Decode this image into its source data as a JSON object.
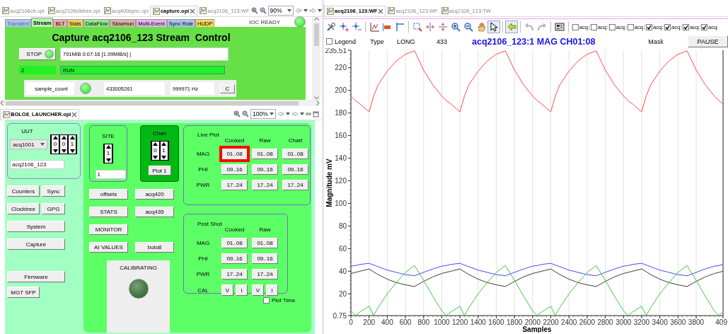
{
  "editor_top": {
    "tabs": [
      {
        "label": "acq2106ctr.opi",
        "selected": false
      },
      {
        "label": "acq2106clktree.opi",
        "selected": false
      },
      {
        "label": "acq400sync.opi",
        "selected": false
      },
      {
        "label": "capture.opi",
        "selected": true
      },
      {
        "label": "acq2106_123:WF",
        "selected": false
      }
    ],
    "zoom": "90%",
    "stream_tabs": [
      {
        "label": "Transient",
        "selected": false,
        "disabled": true,
        "color": "#a9c6ee"
      },
      {
        "label": "Stream",
        "selected": true,
        "disabled": false,
        "color": "#b6f4b0"
      },
      {
        "label": "BLT",
        "selected": false,
        "disabled": false,
        "color": "#f0aaaa"
      },
      {
        "label": "Stats",
        "selected": false,
        "disabled": false,
        "color": "#f0cf5c"
      },
      {
        "label": "DataFlow",
        "selected": false,
        "disabled": false,
        "color": "#92e68e"
      },
      {
        "label": "Slowmon",
        "selected": false,
        "disabled": false,
        "color": "#d9b3a3"
      },
      {
        "label": "Multi-Event",
        "selected": false,
        "disabled": false,
        "color": "#e6b3ef"
      },
      {
        "label": "Sync Role",
        "selected": false,
        "disabled": false,
        "color": "#aac2ef"
      },
      {
        "label": "HUDP",
        "selected": false,
        "disabled": false,
        "color": "#f7d65e"
      }
    ],
    "ioc_status": {
      "label": "IOC READY",
      "on": true
    },
    "panel": {
      "title": "Capture acq2106_123 Stream  Control",
      "stop": {
        "label": "STOP",
        "on": true
      },
      "progress": "791MiB 0:07:16 [1.99MiB/s] |",
      "state_code": "2",
      "state": "RUN",
      "counter": {
        "label": "sample_count",
        "on": true,
        "count": "433005261",
        "rate": "999971 Hz",
        "button": "C"
      }
    }
  },
  "launcher": {
    "tabs": [
      {
        "label": "BOLO8_LAUNCHER.opi",
        "selected": true
      }
    ],
    "zoom": "100%",
    "uut": {
      "title": "UUT",
      "device": "acq1001",
      "digits": [
        "0",
        "0",
        "1"
      ],
      "name": "acq2106_123"
    },
    "nav_buttons": [
      [
        "Counters",
        "Sync"
      ],
      [
        "Clocktree",
        "GPG"
      ],
      [
        "System"
      ],
      [
        "Capture"
      ],
      [
        "Firmware"
      ],
      [
        "MGT SFP"
      ]
    ],
    "site": {
      "title": "SITE",
      "digits": [
        "1"
      ],
      "value": "1"
    },
    "chan": {
      "title": "Chan",
      "digits": [
        "0",
        "1"
      ],
      "button": "Plot 1"
    },
    "tool_buttons": [
      [
        "offsets",
        "acq420"
      ],
      [
        "STATS",
        "acq435"
      ],
      [
        "MONITOR"
      ],
      [
        "AI VALUES",
        "bolo8"
      ]
    ],
    "calibrating": {
      "label": "CALIBRATING",
      "on": false
    },
    "live_plot": {
      "title": "Live Plot",
      "columns": [
        "Cooked",
        "Raw",
        "Chart"
      ],
      "rows": [
        {
          "label": "MAG",
          "buttons": [
            {
              "label": "01..08",
              "highlighted": true
            },
            {
              "label": "01..08",
              "highlighted": false
            },
            {
              "label": "01..08",
              "highlighted": false
            }
          ]
        },
        {
          "label": "PHI",
          "buttons": [
            {
              "label": "09..16",
              "highlighted": false
            },
            {
              "label": "09..16",
              "highlighted": false
            },
            {
              "label": "09..16",
              "highlighted": false
            }
          ]
        },
        {
          "label": "PWR",
          "buttons": [
            {
              "label": "17..24",
              "highlighted": false
            },
            {
              "label": "17..24",
              "highlighted": false
            },
            {
              "label": "17..24",
              "highlighted": false
            }
          ]
        }
      ]
    },
    "post_shot": {
      "title": "Post Shot",
      "columns": [
        "Cooked",
        "Raw"
      ],
      "rows": [
        {
          "label": "MAG",
          "buttons": [
            "01..08",
            "01..08"
          ]
        },
        {
          "label": "PHI",
          "buttons": [
            "09..16",
            "09..16"
          ]
        },
        {
          "label": "PWR",
          "buttons": [
            "17..24",
            "17..24"
          ]
        }
      ],
      "cal": {
        "label": "CAL",
        "buttons": [
          "V",
          "I",
          "V",
          "I"
        ]
      }
    },
    "plot_time": {
      "label": "Plot Time",
      "checked": false
    }
  },
  "plot": {
    "tabs": [
      {
        "label": "acq2106_123:WF",
        "selected": true
      },
      {
        "label": "acq2106_123:WF",
        "selected": false
      },
      {
        "label": "acq2106_123:TW",
        "selected": false
      }
    ],
    "toolbar": [
      {
        "selected": false,
        "disabled": false
      },
      {
        "selected": false,
        "disabled": false
      },
      {
        "selected": false,
        "disabled": false
      },
      {
        "selected": false,
        "disabled": false
      },
      {
        "selected": false,
        "disabled": false
      },
      {
        "selected": false,
        "disabled": false
      },
      {
        "selected": false,
        "disabled": false
      },
      {
        "selected": false,
        "disabled": false
      },
      {
        "selected": false,
        "disabled": false
      },
      {
        "selected": false,
        "disabled": false
      },
      {
        "selected": false,
        "disabled": false
      },
      {
        "selected": false,
        "disabled": false
      },
      {
        "selected": true,
        "disabled": false
      },
      {
        "selected": true,
        "disabled": false
      },
      {
        "selected": false,
        "disabled": true
      },
      {
        "selected": false,
        "disabled": true
      },
      {
        "selected": false,
        "disabled": false
      }
    ],
    "traces": [
      {
        "label": "acq:",
        "checked": false
      },
      {
        "label": "acq:",
        "checked": false
      },
      {
        "label": "acq:",
        "checked": false
      },
      {
        "label": "acq:",
        "checked": false
      },
      {
        "label": "acq:",
        "checked": true
      },
      {
        "label": "acq:",
        "checked": true
      },
      {
        "label": "acq:",
        "checked": true
      },
      {
        "label": "acq:",
        "checked": true
      }
    ],
    "legend": {
      "label": "Legend",
      "checked": false
    },
    "type_label": "Type",
    "type": "LONG",
    "count": "433",
    "title": "acq2106_123:1 MAG CH01:08",
    "mask": "Mask",
    "pause": "PAUSE",
    "x_edge_label": "409",
    "chart_data": {
      "type": "line",
      "grid": true,
      "xlabel": "Samples",
      "ylabel": "Magnitude mV",
      "x": [
        0,
        50,
        100,
        200,
        250,
        300,
        400,
        500,
        600,
        700,
        800,
        900,
        1000,
        1050,
        1100,
        1200,
        1250,
        1300,
        1400,
        1500,
        1600,
        1700,
        1800,
        1900,
        2000,
        2050,
        2100,
        2200,
        2250,
        2300,
        2400,
        2500,
        2600,
        2700,
        2800,
        2900,
        3000,
        3050,
        3100,
        3200,
        3250,
        3300,
        3400,
        3500,
        3600,
        3700,
        3800,
        3900,
        4000,
        4050,
        4096
      ],
      "series": [
        {
          "color": "#ff4a4a",
          "values": [
            195,
            191,
            188,
            181,
            195,
            205,
            217,
            226,
            232,
            235,
            218,
            205,
            195,
            191,
            188,
            181,
            195,
            205,
            217,
            226,
            232,
            235,
            218,
            205,
            195,
            191,
            188,
            181,
            195,
            205,
            217,
            226,
            232,
            235,
            218,
            205,
            195,
            191,
            188,
            181,
            195,
            205,
            217,
            226,
            232,
            235,
            218,
            205,
            195,
            191,
            188
          ]
        },
        {
          "color": "#4848f0",
          "values": [
            44.5,
            45,
            46,
            47,
            45.5,
            44,
            41,
            39,
            37,
            36,
            39,
            42,
            44.5,
            45,
            46,
            47,
            45.5,
            44,
            41,
            39,
            37,
            36,
            39,
            42,
            44.5,
            45,
            46,
            47,
            45.5,
            44,
            41,
            39,
            37,
            36,
            39,
            42,
            44.5,
            45,
            46,
            47,
            45.5,
            44,
            41,
            39,
            37,
            36,
            39,
            42,
            44.5,
            45,
            46
          ]
        },
        {
          "color": "#3c3c3c",
          "values": [
            38,
            39,
            40,
            42,
            39.5,
            37,
            33,
            30,
            28,
            26.5,
            31,
            35,
            38,
            39,
            40,
            42,
            39.5,
            37,
            33,
            30,
            28,
            26.5,
            31,
            35,
            38,
            39,
            40,
            42,
            39.5,
            37,
            33,
            30,
            28,
            26.5,
            31,
            35,
            38,
            39,
            40,
            42,
            39.5,
            37,
            33,
            30,
            28,
            26.5,
            31,
            35,
            38,
            39,
            40
          ]
        },
        {
          "color": "#3cc83c",
          "values": [
            5,
            0.75,
            4,
            9,
            0.75,
            8,
            20,
            30,
            39,
            45,
            32,
            18,
            5,
            0.75,
            4,
            9,
            0.75,
            8,
            20,
            30,
            39,
            45,
            32,
            18,
            5,
            0.75,
            4,
            9,
            0.75,
            8,
            20,
            30,
            39,
            45,
            32,
            18,
            5,
            0.75,
            4,
            9,
            0.75,
            8,
            20,
            30,
            39,
            45,
            32,
            18,
            5,
            0.75,
            4
          ]
        }
      ],
      "xlim": [
        0,
        4096
      ],
      "ylim": [
        0.75,
        235.51
      ],
      "xticks": [
        0,
        200,
        400,
        600,
        800,
        1000,
        1200,
        1400,
        1600,
        1800,
        2000,
        2200,
        2400,
        2600,
        2800,
        3000,
        3200,
        3400,
        3600,
        3800
      ],
      "yticks": [
        0.75,
        20,
        40,
        60,
        80,
        100,
        120,
        140,
        160,
        180,
        200,
        220,
        235.51
      ]
    }
  }
}
